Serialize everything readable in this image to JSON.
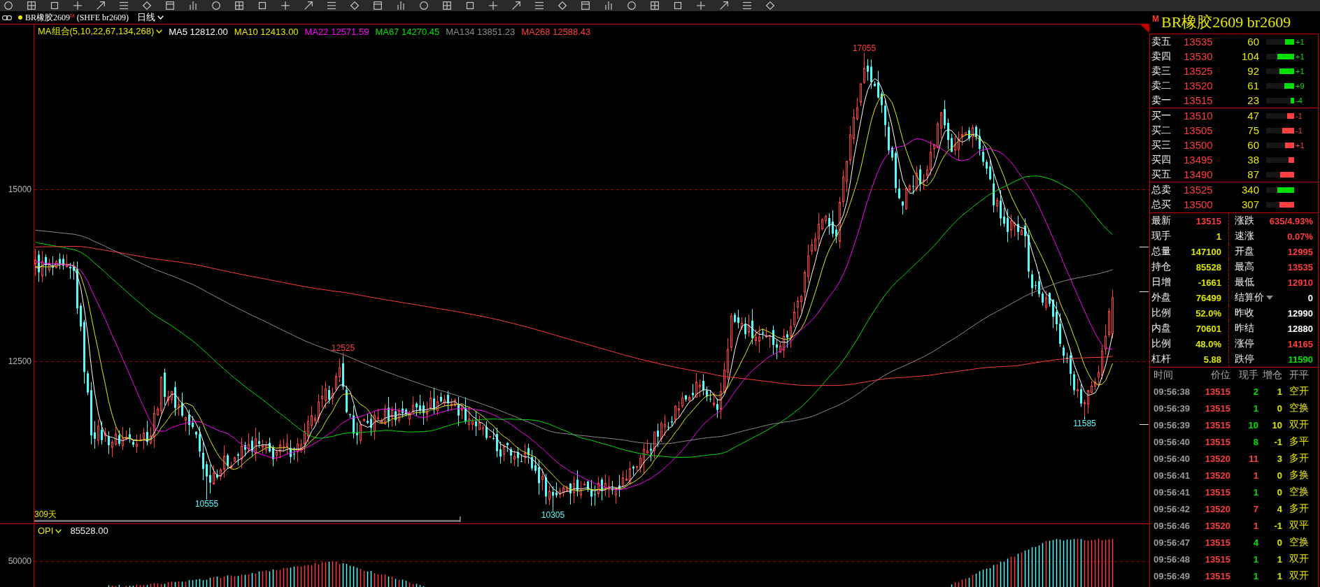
{
  "header": {
    "symbol": "BR橡胶2609",
    "badge": "M",
    "exchange_code": "(SHFE br2609)",
    "period": "日线"
  },
  "ma_legend": {
    "label": "MA组合(5,10,22,67,134,268)",
    "items": [
      {
        "text": "MA5 12812.00",
        "color": "#ffffff"
      },
      {
        "text": "MA10 12413.00",
        "color": "#e6e600"
      },
      {
        "text": "MA22 12571.59",
        "color": "#ff00ff"
      },
      {
        "text": "MA67 14270.45",
        "color": "#00e000"
      },
      {
        "text": "MA134 13851.23",
        "color": "#8c8c8c"
      },
      {
        "text": "MA268 12588.43",
        "color": "#ff3c3c"
      }
    ]
  },
  "price_chart": {
    "y_labels": [
      "15000",
      "12500"
    ],
    "markers": [
      {
        "text": "10555",
        "kind": "low"
      },
      {
        "text": "12525",
        "kind": "high"
      },
      {
        "text": "10305",
        "kind": "low"
      },
      {
        "text": "17055",
        "kind": "high"
      },
      {
        "text": "11585",
        "kind": "low"
      }
    ],
    "range_label": "309天"
  },
  "opi_panel": {
    "label": "OPI",
    "value": "85528.00",
    "y_labels": [
      "50000"
    ]
  },
  "quote_panel": {
    "badge": "M",
    "title": "BR橡胶2609 br2609",
    "asks": [
      {
        "label": "卖五",
        "price": "13535",
        "volume": "60",
        "level": 0.33,
        "color": "#00e000",
        "change": "+1"
      },
      {
        "label": "卖四",
        "price": "13530",
        "volume": "104",
        "level": 0.6,
        "color": "#00e000",
        "change": "+1"
      },
      {
        "label": "卖三",
        "price": "13525",
        "volume": "92",
        "level": 0.53,
        "color": "#00e000",
        "change": "+1"
      },
      {
        "label": "卖二",
        "price": "13520",
        "volume": "61",
        "level": 0.35,
        "color": "#00e000",
        "change": "+9"
      },
      {
        "label": "卖一",
        "price": "13515",
        "volume": "23",
        "level": 0.13,
        "color": "#00e000",
        "change": "-4"
      }
    ],
    "bids": [
      {
        "label": "买一",
        "price": "13510",
        "volume": "47",
        "level": 0.25,
        "color": "#ff4040",
        "change": "-1"
      },
      {
        "label": "买二",
        "price": "13505",
        "volume": "75",
        "level": 0.43,
        "color": "#ff4040",
        "change": "-1"
      },
      {
        "label": "买三",
        "price": "13500",
        "volume": "60",
        "level": 0.33,
        "color": "#ff4040",
        "change": "+1"
      },
      {
        "label": "买四",
        "price": "13495",
        "volume": "38",
        "level": 0.2,
        "color": "#ff4040"
      },
      {
        "label": "买五",
        "price": "13490",
        "volume": "87",
        "level": 0.5,
        "color": "#ff4040"
      }
    ],
    "totals": [
      {
        "label": "总卖",
        "price": "13525",
        "volume": "340",
        "level": 0.6,
        "color": "#00e000"
      },
      {
        "label": "总买",
        "price": "13500",
        "volume": "307",
        "level": 0.53,
        "color": "#ff4040"
      }
    ],
    "stats": [
      {
        "left": {
          "label": "最新",
          "value": "13515",
          "color": "#ff3c3c",
          "kind": "plain"
        },
        "right": {
          "label": "涨跌",
          "value": "635/4.93%",
          "color": "#ff3c3c",
          "kind": "plain"
        }
      },
      {
        "left": {
          "label": "现手",
          "value": "1",
          "color": "#dce600",
          "kind": "plain"
        },
        "right": {
          "label": "速涨",
          "value": "0.07%",
          "color": "#ff3c3c",
          "kind": "plain"
        }
      },
      {
        "left": {
          "label": "总量",
          "value": "147100",
          "color": "#dce600",
          "kind": "plain"
        },
        "right": {
          "label": "开盘",
          "value": "12995",
          "color": "#ff3c3c",
          "kind": "plain"
        }
      },
      {
        "left": {
          "label": "持仓",
          "value": "85528",
          "color": "#dce600",
          "kind": "plain"
        },
        "right": {
          "label": "最高",
          "value": "13535",
          "color": "#ff3c3c",
          "kind": "plain"
        }
      },
      {
        "left": {
          "label": "日增",
          "value": "-1661",
          "color": "#dce600",
          "kind": "plain"
        },
        "right": {
          "label": "最低",
          "value": "12910",
          "color": "#ff3c3c",
          "kind": "plain"
        }
      },
      {
        "left": {
          "label": "外盘",
          "value": "76499",
          "color": "#dce600",
          "kind": "plain"
        },
        "right": {
          "label": "结算价",
          "value": "0",
          "color": "#ffffff",
          "kind": "dropdown"
        }
      },
      {
        "left": {
          "label": "比例",
          "value": "52.0%",
          "color": "#dce600",
          "kind": "plain"
        },
        "right": {
          "label": "昨收",
          "value": "12990",
          "color": "#ffffff",
          "kind": "plain"
        }
      },
      {
        "left": {
          "label": "内盘",
          "value": "70601",
          "color": "#dce600",
          "kind": "plain"
        },
        "right": {
          "label": "昨结",
          "value": "12880",
          "color": "#ffffff",
          "kind": "plain"
        }
      },
      {
        "left": {
          "label": "比例",
          "value": "48.0%",
          "color": "#dce600",
          "kind": "plain"
        },
        "right": {
          "label": "涨停",
          "value": "14165",
          "color": "#ff3c3c",
          "kind": "plain"
        }
      },
      {
        "left": {
          "label": "杠杆",
          "value": "5.88",
          "color": "#dce600",
          "kind": "plain"
        },
        "right": {
          "label": "跌停",
          "value": "11590",
          "color": "#00e000",
          "kind": "plain"
        }
      }
    ],
    "ticks": {
      "columns": [
        "时间",
        "价位",
        "现手",
        "增仓",
        "开平"
      ],
      "rows": [
        {
          "time": "09:56:38",
          "price": "13515",
          "volume": "2",
          "color": "#00e000",
          "oi_change": "1",
          "type": "空开"
        },
        {
          "time": "09:56:39",
          "price": "13515",
          "volume": "1",
          "color": "#00e000",
          "oi_change": "0",
          "type": "空换"
        },
        {
          "time": "09:56:39",
          "price": "13515",
          "volume": "10",
          "color": "#00e000",
          "oi_change": "10",
          "type": "双开"
        },
        {
          "time": "09:56:40",
          "price": "13515",
          "volume": "8",
          "color": "#00e000",
          "oi_change": "-1",
          "type": "多平"
        },
        {
          "time": "09:56:40",
          "price": "13520",
          "volume": "11",
          "color": "#ff4040",
          "oi_change": "3",
          "type": "多开"
        },
        {
          "time": "09:56:41",
          "price": "13520",
          "volume": "1",
          "color": "#ff4040",
          "oi_change": "0",
          "type": "多换"
        },
        {
          "time": "09:56:41",
          "price": "13515",
          "volume": "1",
          "color": "#00e000",
          "oi_change": "0",
          "type": "空换"
        },
        {
          "time": "09:56:42",
          "price": "13520",
          "volume": "7",
          "color": "#ff4040",
          "oi_change": "4",
          "type": "多开"
        },
        {
          "time": "09:56:46",
          "price": "13520",
          "volume": "1",
          "color": "#ff4040",
          "oi_change": "-1",
          "type": "双平"
        },
        {
          "time": "09:56:47",
          "price": "13515",
          "volume": "4",
          "color": "#00e000",
          "oi_change": "0",
          "type": "空换"
        },
        {
          "time": "09:56:48",
          "price": "13515",
          "volume": "1",
          "color": "#00e000",
          "oi_change": "1",
          "type": "双开"
        },
        {
          "time": "09:56:49",
          "price": "13515",
          "volume": "1",
          "color": "#00e000",
          "oi_change": "1",
          "type": "双开"
        }
      ]
    }
  }
}
